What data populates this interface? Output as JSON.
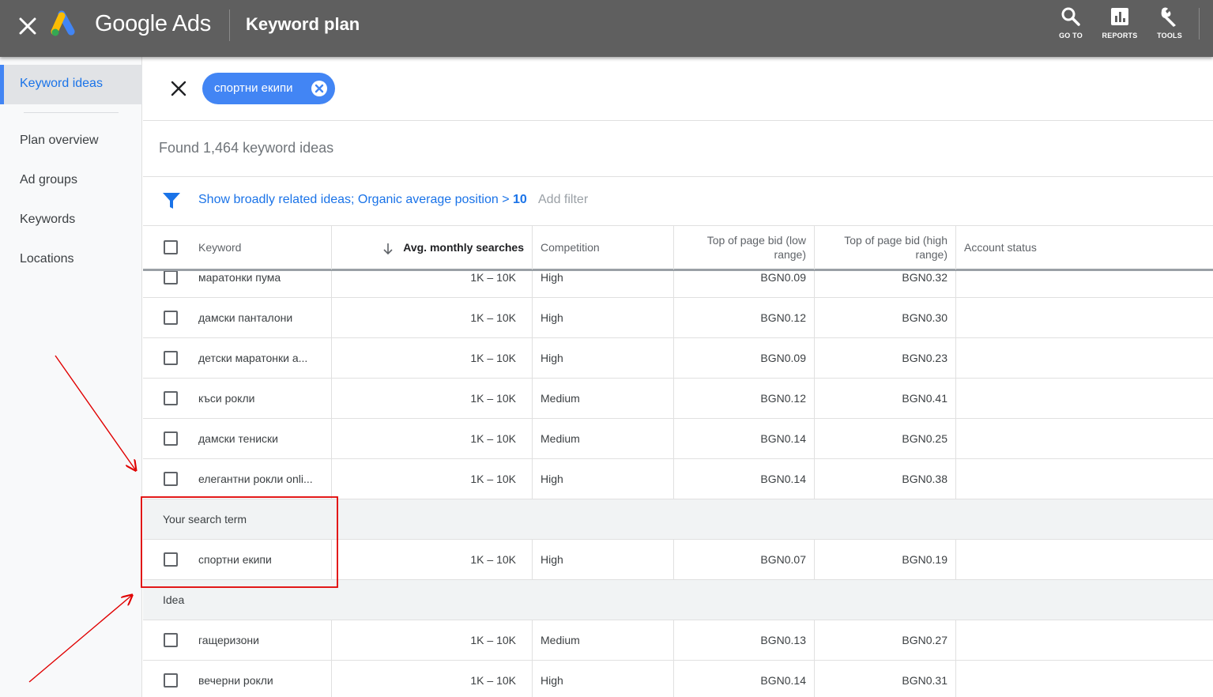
{
  "header": {
    "brand": "Google Ads",
    "title": "Keyword plan",
    "tools": [
      {
        "label": "GO TO",
        "icon": "search-icon"
      },
      {
        "label": "REPORTS",
        "icon": "bar-chart-icon"
      },
      {
        "label": "TOOLS",
        "icon": "wrench-icon"
      }
    ]
  },
  "sidebar": {
    "active": "Keyword ideas",
    "items": [
      "Plan overview",
      "Ad groups",
      "Keywords",
      "Locations"
    ]
  },
  "search": {
    "chip": "спортни екипи"
  },
  "results": {
    "found": "Found 1,464 keyword ideas",
    "filter_text": "Show broadly related ideas; Organic average position >",
    "filter_value": "10",
    "add_filter": "Add filter"
  },
  "table": {
    "columns": {
      "keyword": "Keyword",
      "searches": "Avg. monthly searches",
      "competition": "Competition",
      "bid_low_1": "Top of page bid (low",
      "bid_low_2": "range)",
      "bid_high_1": "Top of page bid (high",
      "bid_high_2": "range)",
      "status": "Account status"
    },
    "rows_top": [
      {
        "keyword": "маратонки пума",
        "searches": "1K – 10K",
        "competition": "High",
        "low": "BGN0.09",
        "high": "BGN0.32"
      },
      {
        "keyword": "дамски панталони",
        "searches": "1K – 10K",
        "competition": "High",
        "low": "BGN0.12",
        "high": "BGN0.30"
      },
      {
        "keyword": "детски маратонки а...",
        "searches": "1K – 10K",
        "competition": "High",
        "low": "BGN0.09",
        "high": "BGN0.23"
      },
      {
        "keyword": "къси рокли",
        "searches": "1K – 10K",
        "competition": "Medium",
        "low": "BGN0.12",
        "high": "BGN0.41"
      },
      {
        "keyword": "дамски тениски",
        "searches": "1K – 10K",
        "competition": "Medium",
        "low": "BGN0.14",
        "high": "BGN0.25"
      },
      {
        "keyword": "елегантни рокли onli...",
        "searches": "1K – 10K",
        "competition": "High",
        "low": "BGN0.14",
        "high": "BGN0.38"
      }
    ],
    "search_term_label": "Your search term",
    "search_term_row": {
      "keyword": "спортни екипи",
      "searches": "1K – 10K",
      "competition": "High",
      "low": "BGN0.07",
      "high": "BGN0.19"
    },
    "idea_label": "Idea",
    "rows_bottom": [
      {
        "keyword": "гащеризони",
        "searches": "1K – 10K",
        "competition": "Medium",
        "low": "BGN0.13",
        "high": "BGN0.27"
      },
      {
        "keyword": "вечерни рокли",
        "searches": "1K – 10K",
        "competition": "High",
        "low": "BGN0.14",
        "high": "BGN0.31"
      }
    ]
  },
  "colors": {
    "topbar": "#5f5f5f",
    "accent": "#1a73e8",
    "chip": "#4285f4",
    "annotation": "#e00000"
  }
}
